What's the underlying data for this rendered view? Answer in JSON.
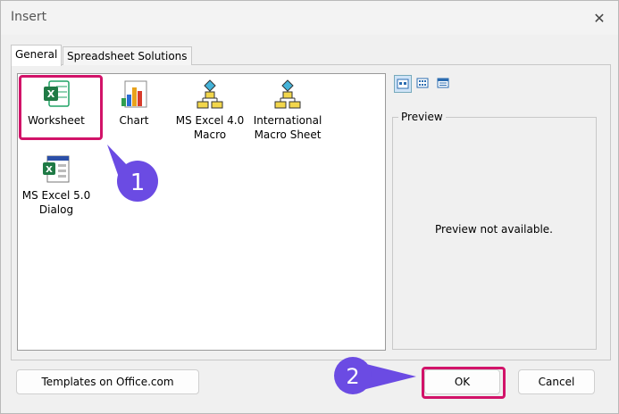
{
  "window": {
    "title": "Insert",
    "close_glyph": "✕"
  },
  "tabs": [
    {
      "label": "General",
      "active": true
    },
    {
      "label": "Spreadsheet Solutions",
      "active": false
    }
  ],
  "templates": [
    {
      "label": "Worksheet",
      "icon": "excel-worksheet-icon",
      "selected": true
    },
    {
      "label": "Chart",
      "icon": "chart-icon"
    },
    {
      "label": "MS Excel 4.0 Macro",
      "icon": "macro-flowchart-icon"
    },
    {
      "label": "International Macro Sheet",
      "icon": "macro-flowchart-icon"
    },
    {
      "label": "MS Excel 5.0 Dialog",
      "icon": "excel-dialog-icon"
    }
  ],
  "view_buttons": [
    {
      "name": "large-icons-view-icon",
      "active": true
    },
    {
      "name": "list-view-icon",
      "active": false
    },
    {
      "name": "details-view-icon",
      "active": false
    }
  ],
  "preview": {
    "label": "Preview",
    "text": "Preview not available."
  },
  "buttons": {
    "templates_online": "Templates on Office.com",
    "ok": "OK",
    "cancel": "Cancel"
  },
  "annotations": {
    "step1": "1",
    "step2": "2"
  },
  "colors": {
    "highlight": "#d21369",
    "badge": "#6b4be3",
    "excel_green": "#1f7a45"
  }
}
